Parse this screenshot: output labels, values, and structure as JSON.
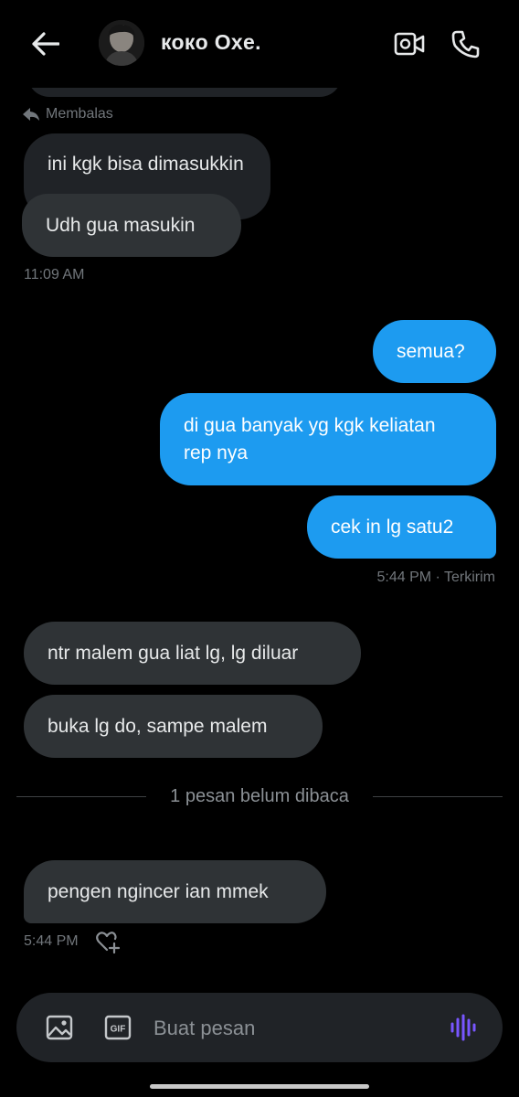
{
  "header": {
    "contact_name": "кокo Oxe.",
    "back_icon": "arrow-left-icon",
    "video_icon": "video-camera-icon",
    "call_icon": "phone-icon"
  },
  "messages": {
    "reply_label": "Membalas",
    "quoted_text": "ini kgk bisa dimasukkin",
    "msg1": "Udh gua masukin",
    "time1": "11:09 AM",
    "out1": "semua?",
    "out2_line1": "di gua banyak yg kgk keliatan",
    "out2_line2": "rep nya",
    "out3": "cek in lg satu2",
    "time2": "5:44 PM · Terkirim",
    "in2": "ntr malem gua liat lg, lg diluar",
    "in3": "buka lg do, sampe malem",
    "unread_divider": "1 pesan belum dibaca",
    "in4": "pengen ngincer ian mmek",
    "time3": "5:44 PM"
  },
  "composer": {
    "placeholder": "Buat pesan",
    "gif_label": "GIF"
  },
  "colors": {
    "outgoing": "#1d9bf0",
    "incoming": "#2f3336",
    "voice_accent": "#7856ff"
  }
}
